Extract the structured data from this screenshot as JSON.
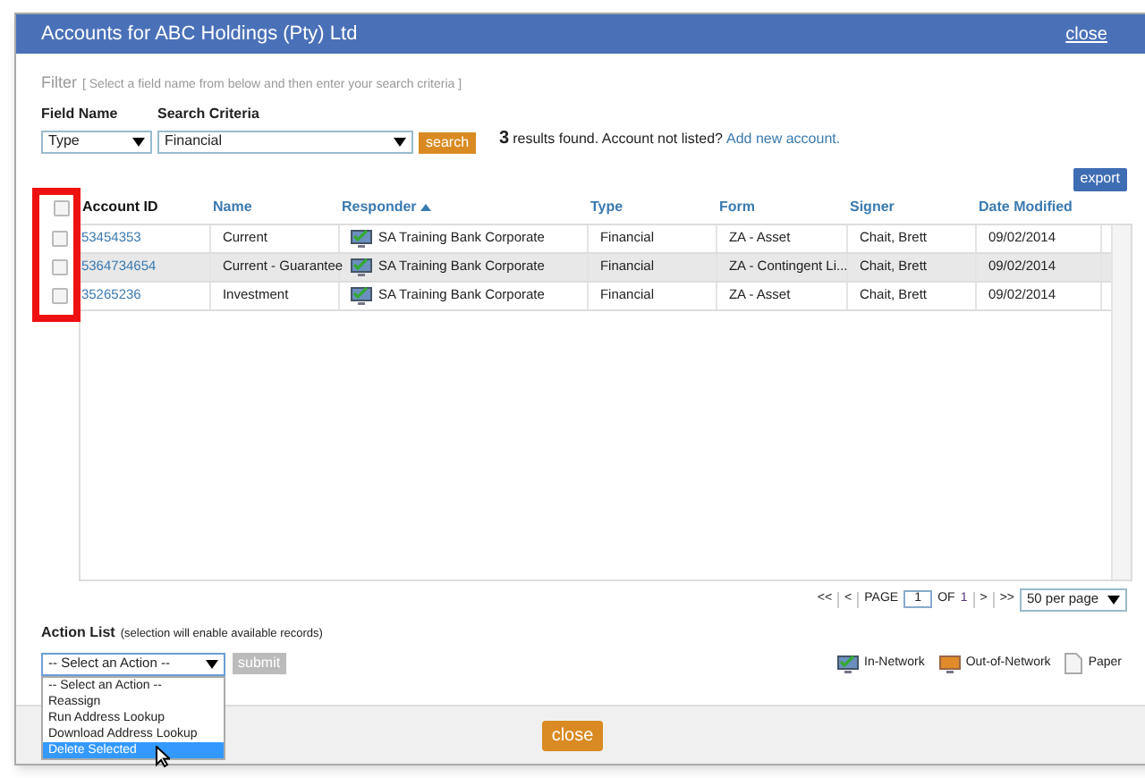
{
  "window": {
    "title": "Accounts for ABC Holdings (Pty) Ltd",
    "close_link": "close"
  },
  "filter": {
    "label": "Filter",
    "hint": "[ Select a field name from below and then enter your search criteria ]",
    "field_name": {
      "label": "Field Name",
      "value": "Type"
    },
    "search_criteria": {
      "label": "Search Criteria",
      "value": "Financial"
    },
    "search_button": "search",
    "result_count": "3",
    "result_text": "results found. Account not listed?",
    "add_link": "Add new account."
  },
  "export_button": "export",
  "table": {
    "columns": [
      {
        "label": "Account ID",
        "sorted": false,
        "link": false
      },
      {
        "label": "Name",
        "sorted": false,
        "link": true
      },
      {
        "label": "Responder",
        "sorted": true,
        "link": true
      },
      {
        "label": "Type",
        "sorted": false,
        "link": true
      },
      {
        "label": "Form",
        "sorted": false,
        "link": true
      },
      {
        "label": "Signer",
        "sorted": false,
        "link": true
      },
      {
        "label": "Date Modified",
        "sorted": false,
        "link": true
      }
    ],
    "select_all_checked": false,
    "rows": [
      {
        "checked": false,
        "selected": false,
        "cells": [
          "53454353",
          "Current",
          "SA Training Bank Corporate",
          "Financial",
          "ZA - Asset",
          "Chait, Brett",
          "09/02/2014"
        ]
      },
      {
        "checked": false,
        "selected": true,
        "cells": [
          "5364734654",
          "Current - Guarantee",
          "SA Training Bank Corporate",
          "Financial",
          "ZA - Contingent Li...",
          "Chait, Brett",
          "09/02/2014"
        ]
      },
      {
        "checked": false,
        "selected": false,
        "cells": [
          "35265236",
          "Investment",
          "SA Training Bank Corporate",
          "Financial",
          "ZA - Asset",
          "Chait, Brett",
          "09/02/2014"
        ]
      }
    ]
  },
  "pagination": {
    "first": "<<",
    "prev": "<",
    "page_label": "PAGE",
    "page": "1",
    "of_label": "OF",
    "total": "1",
    "next": ">",
    "last": ">>",
    "per_page": "50 per page"
  },
  "action_list": {
    "label": "Action List",
    "hint": "(selection will enable available records)",
    "value": "-- Select an Action --",
    "submit": "submit",
    "submit_disabled": true,
    "options": [
      {
        "label": "-- Select an Action --",
        "highlighted": false
      },
      {
        "label": "Reassign",
        "highlighted": false
      },
      {
        "label": "Run Address Lookup",
        "highlighted": false
      },
      {
        "label": "Download Address Lookup",
        "highlighted": false
      },
      {
        "label": "Delete Selected",
        "highlighted": true
      }
    ]
  },
  "legend": [
    {
      "kind": "in-network",
      "label": "In-Network"
    },
    {
      "kind": "out-of-network",
      "label": "Out-of-Network"
    },
    {
      "kind": "paper",
      "label": "Paper"
    }
  ],
  "close_button": "close"
}
